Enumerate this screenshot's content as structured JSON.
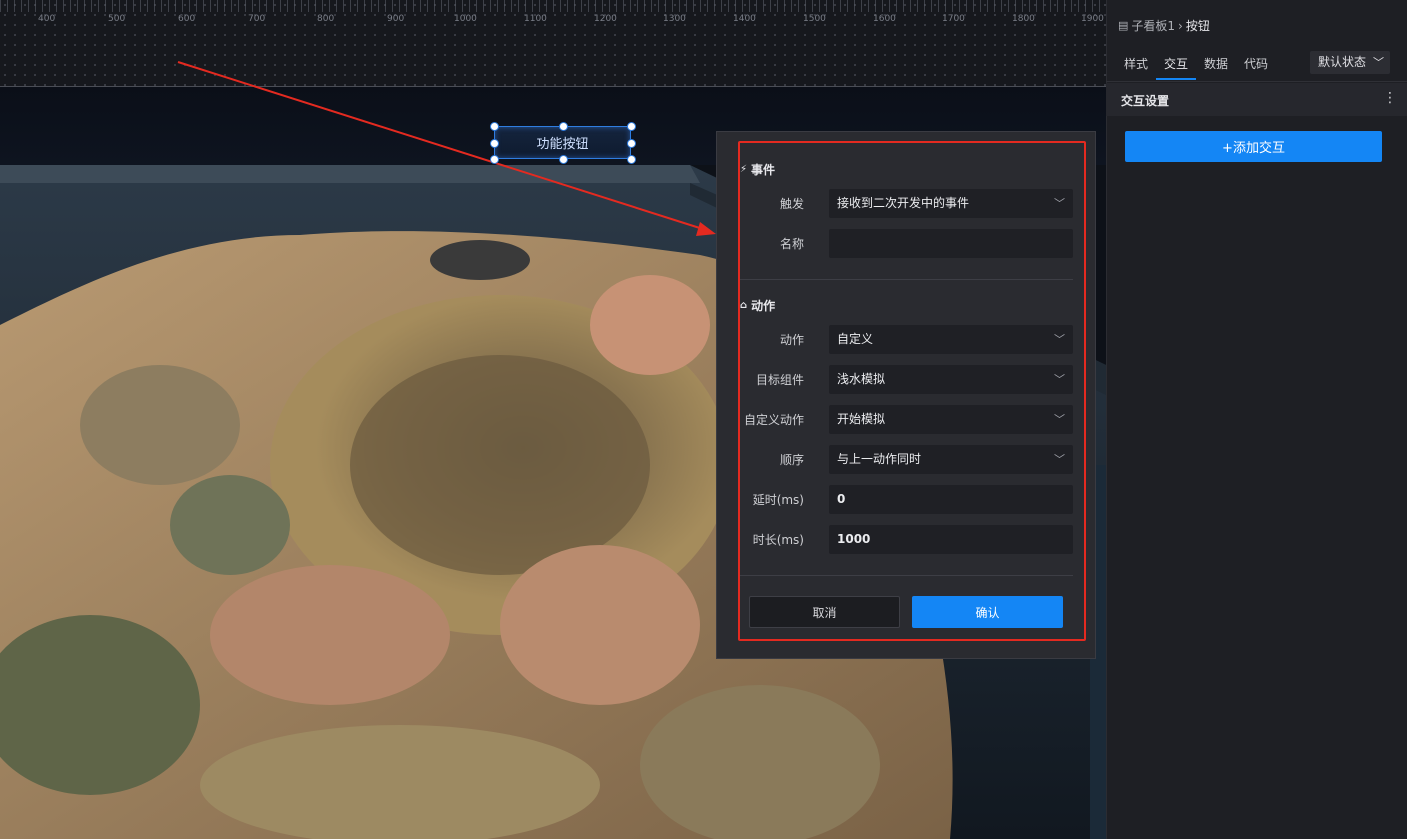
{
  "canvas": {
    "ruler_labels": [
      "400",
      "500",
      "600",
      "700",
      "800",
      "900",
      "1000",
      "1100",
      "1200",
      "1300",
      "1400",
      "1500",
      "1600",
      "1700",
      "1800",
      "1900"
    ],
    "function_button_label": "功能按钮"
  },
  "modal": {
    "event_section_icon": "lightning-icon",
    "event_section_title": "事件",
    "trigger_label": "触发",
    "trigger_value": "接收到二次开发中的事件",
    "name_label": "名称",
    "name_value": "",
    "action_section_icon": "house-icon",
    "action_section_title": "动作",
    "action_label": "动作",
    "action_value": "自定义",
    "target_label": "目标组件",
    "target_value": "浅水模拟",
    "custom_action_label": "自定义动作",
    "custom_action_value": "开始模拟",
    "order_label": "顺序",
    "order_value": "与上一动作同时",
    "delay_label": "延时(ms)",
    "delay_value": "0",
    "duration_label": "时长(ms)",
    "duration_value": "1000",
    "cancel_label": "取消",
    "confirm_label": "确认",
    "highlight_color": "#e42a20"
  },
  "panel": {
    "breadcrumb_parent": "子看板1",
    "breadcrumb_sep": "›",
    "breadcrumb_current": "按钮",
    "tabs": [
      "样式",
      "交互",
      "数据",
      "代码"
    ],
    "active_tab": "交互",
    "state_select": "默认状态",
    "section_title": "交互设置",
    "add_button": "+添加交互",
    "accent": "#1486f5"
  }
}
